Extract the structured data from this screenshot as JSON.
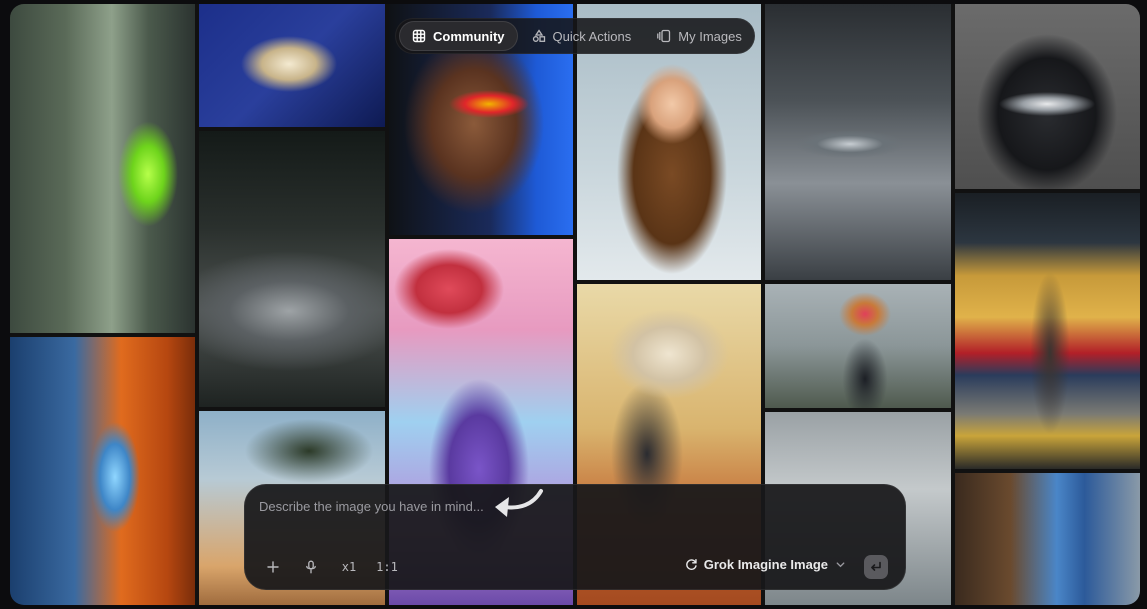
{
  "nav": {
    "tabs": [
      {
        "label": "Community",
        "icon": "grid-icon",
        "active": true
      },
      {
        "label": "Quick Actions",
        "icon": "shapes-icon",
        "active": false
      },
      {
        "label": "My Images",
        "icon": "gallery-icon",
        "active": false
      }
    ]
  },
  "composer": {
    "placeholder": "Describe the image you have in mind...",
    "count_label": "x1",
    "aspect_label": "1:1",
    "model_label": "Grok Imagine Image"
  },
  "gallery": {
    "tiles": [
      {
        "id": "lab",
        "name": "specimen-lab-image"
      },
      {
        "id": "perfume",
        "name": "perfume-bottle-image"
      },
      {
        "id": "dragon",
        "name": "dragon-image"
      },
      {
        "id": "river",
        "name": "river-rapids-image"
      },
      {
        "id": "tree",
        "name": "coastal-tree-image"
      },
      {
        "id": "woman",
        "name": "woman-sunglasses-image"
      },
      {
        "id": "geisha",
        "name": "anime-umbrella-image"
      },
      {
        "id": "baby",
        "name": "baby-costume-image"
      },
      {
        "id": "gothic",
        "name": "robot-american-gothic-image"
      },
      {
        "id": "ufo",
        "name": "ufo-clouds-image"
      },
      {
        "id": "bouquet",
        "name": "flower-head-image"
      },
      {
        "id": "fog",
        "name": "fog-image"
      },
      {
        "id": "cat",
        "name": "cat-sunglasses-image"
      },
      {
        "id": "train",
        "name": "train-platform-image"
      },
      {
        "id": "alley",
        "name": "alley-image"
      }
    ]
  },
  "colors": {
    "background": "#0c0c0e",
    "panel": "#18181a",
    "active_tab": "#2a2a2e",
    "send_button": "#5a5a5e"
  }
}
